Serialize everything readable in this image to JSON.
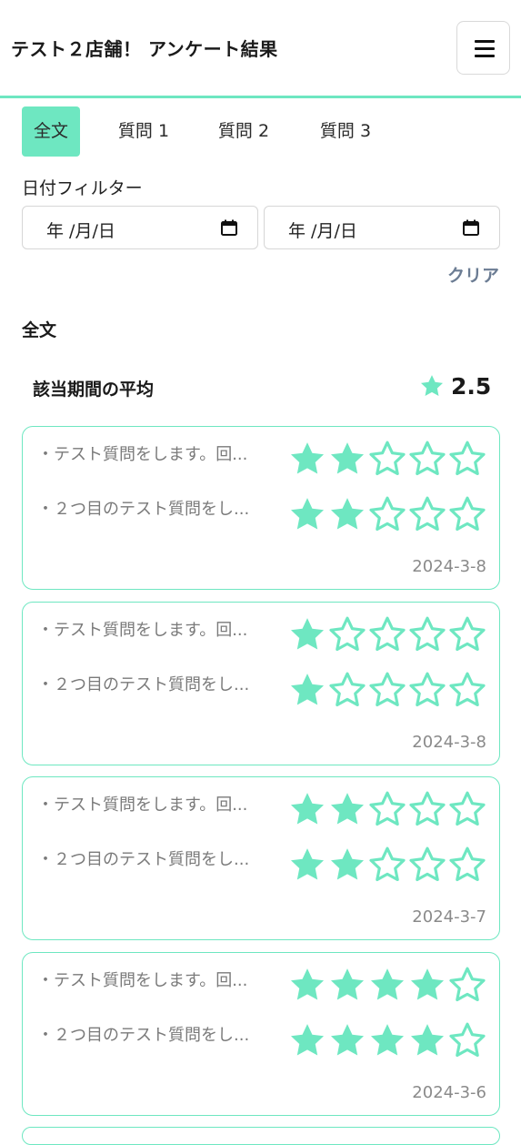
{
  "header": {
    "title": "テスト２店舗！ アンケート結果"
  },
  "tabs": [
    {
      "label": "全文",
      "active": true
    },
    {
      "label": "質問 1",
      "active": false
    },
    {
      "label": "質問 2",
      "active": false
    },
    {
      "label": "質問 3",
      "active": false
    }
  ],
  "filter": {
    "label": "日付フィルター",
    "start_placeholder": "年 /月/日",
    "end_placeholder": "年 /月/日",
    "clear_label": "クリア"
  },
  "section_title": "全文",
  "average": {
    "label": "該当期間の平均",
    "value": "2.5"
  },
  "responses": [
    {
      "q1_text": "・テスト質問をします。回...",
      "q1_rating": 2,
      "q2_text": "・２つ目のテスト質問をし...",
      "q2_rating": 2,
      "date": "2024-3-8"
    },
    {
      "q1_text": "・テスト質問をします。回...",
      "q1_rating": 1,
      "q2_text": "・２つ目のテスト質問をし...",
      "q2_rating": 1,
      "date": "2024-3-8"
    },
    {
      "q1_text": "・テスト質問をします。回...",
      "q1_rating": 2,
      "q2_text": "・２つ目のテスト質問をし...",
      "q2_rating": 2,
      "date": "2024-3-7"
    },
    {
      "q1_text": "・テスト質問をします。回...",
      "q1_rating": 4,
      "q2_text": "・２つ目のテスト質問をし...",
      "q2_rating": 4,
      "date": "2024-3-6"
    }
  ],
  "colors": {
    "accent": "#6ee7c1",
    "border": "#d9d9d9",
    "muted_text": "#7a7a7a",
    "clear_link": "#6b7c93"
  },
  "icons": {
    "menu": "hamburger-menu-icon",
    "calendar": "calendar-icon",
    "star": "star-icon"
  },
  "max_rating": 5
}
